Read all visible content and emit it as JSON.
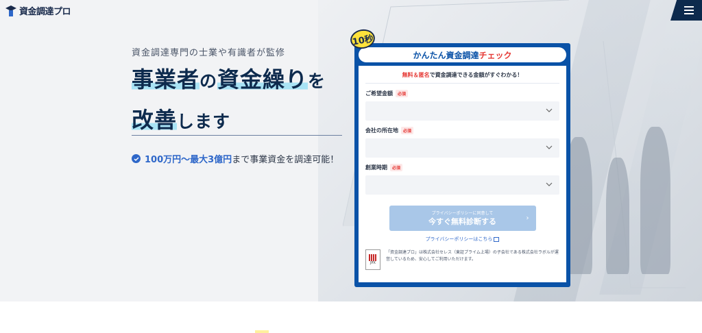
{
  "header": {
    "logo_text": "資金調達プロ",
    "logo_icon": "graduation-cap-icon",
    "menu_icon": "hamburger-icon"
  },
  "hero": {
    "subtitle": "資金調達専門の士業や有識者が監修",
    "headline_1a": "事業者",
    "headline_1b": "の",
    "headline_1c": "資金繰り",
    "headline_1d": "を",
    "headline_2a": "改善",
    "headline_2b": "します",
    "benefit_prefix": "100万円〜最大3億円",
    "benefit_suffix": "まで事業資金を調達可能！"
  },
  "form": {
    "badge": "10秒",
    "title_main": "かんたん資金調達",
    "title_accent": "チェック",
    "lead_accent": "無料＆匿名",
    "lead_rest": "で資金調達できる金額がすぐわかる！",
    "required_label": "必須",
    "fields": [
      {
        "label": "ご希望金額",
        "value": ""
      },
      {
        "label": "会社の所在地",
        "value": ""
      },
      {
        "label": "創業時期",
        "value": ""
      }
    ],
    "submit_small": "プライバシーポリシーに同意して",
    "submit_large": "今すぐ無料診断する",
    "policy_link": "プライバシーポリシーはこちら",
    "jpx_label": "JPX",
    "note": "「資金調達プロ」は株式会社セレス（東証プライム上場）の子会社である株式会社ラボルが運営しているため、安心してご利用いただけます。"
  },
  "colors": {
    "navy": "#0d2a4d",
    "form_blue": "#0a52a7",
    "accent_red": "#e53935",
    "highlight": "#a9e3f5",
    "badge_yellow": "#ffe23b"
  }
}
